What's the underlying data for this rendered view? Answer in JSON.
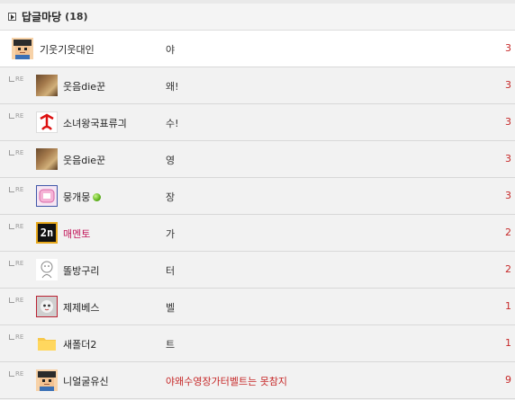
{
  "header": {
    "title": "답글마당",
    "count": "(18)"
  },
  "rows": [
    {
      "name": "기웃기웃대인",
      "message": "야",
      "number": "3",
      "avatar_icon": "pixel-character-avatar"
    },
    {
      "name": "웃음die꾼",
      "message": "왜!",
      "number": "3",
      "avatar_icon": "photo-avatar"
    },
    {
      "name": "소녀왕국표류긔",
      "message": "수!",
      "number": "3",
      "avatar_icon": "red-figure-avatar"
    },
    {
      "name": "웃음die꾼",
      "message": "영",
      "number": "3",
      "avatar_icon": "photo-avatar"
    },
    {
      "name": "뭉개뭉",
      "message": "장",
      "number": "3",
      "avatar_icon": "pink-sticker-avatar",
      "online": true
    },
    {
      "name": "매멘토",
      "message": "가",
      "number": "2",
      "avatar_icon": "2n-logo-avatar"
    },
    {
      "name": "똘방구리",
      "message": "터",
      "number": "2",
      "avatar_icon": "sketch-avatar"
    },
    {
      "name": "제제베스",
      "message": "벨",
      "number": "1",
      "avatar_icon": "doll-face-avatar"
    },
    {
      "name": "새폴더2",
      "message": "트",
      "number": "1",
      "avatar_icon": "folder-avatar"
    },
    {
      "name": "니얼굴유신",
      "message": "야왜수영장가터벨트는 못참지",
      "number": "9",
      "avatar_icon": "pixel-character-avatar"
    }
  ],
  "re_label": "RE",
  "colors": {
    "number": "#c62828",
    "pink_name": "#c2185b",
    "red_message": "#c62828"
  }
}
